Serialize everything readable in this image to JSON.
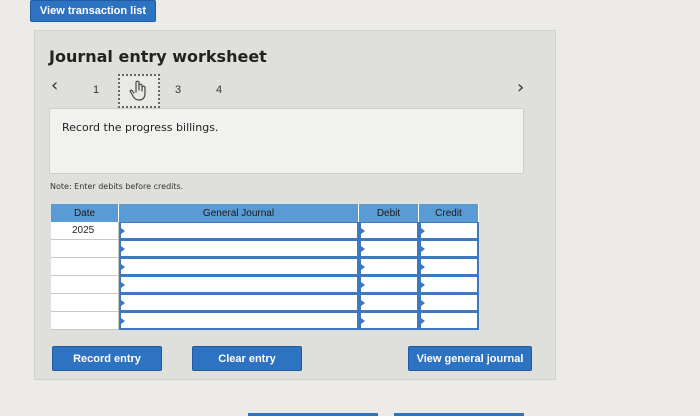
{
  "top": {
    "view_list_label": "View transaction list"
  },
  "worksheet": {
    "title": "Journal entry worksheet",
    "steps": [
      "1",
      "3",
      "4"
    ],
    "instruction": "Record the progress billings.",
    "note": "Note: Enter debits before credits."
  },
  "table": {
    "headers": [
      "Date",
      "General Journal",
      "Debit",
      "Credit"
    ],
    "rows": [
      {
        "date": "2025"
      },
      {
        "date": ""
      },
      {
        "date": ""
      },
      {
        "date": ""
      },
      {
        "date": ""
      },
      {
        "date": ""
      }
    ]
  },
  "buttons": {
    "record": "Record entry",
    "clear": "Clear entry",
    "view_general": "View general journal"
  },
  "icons": {
    "prev": "chevron-left-icon",
    "next": "chevron-right-icon",
    "hand": "hand-cursor-icon"
  },
  "colors": {
    "accent": "#2e72c2",
    "table_header": "#5b9bd5"
  }
}
